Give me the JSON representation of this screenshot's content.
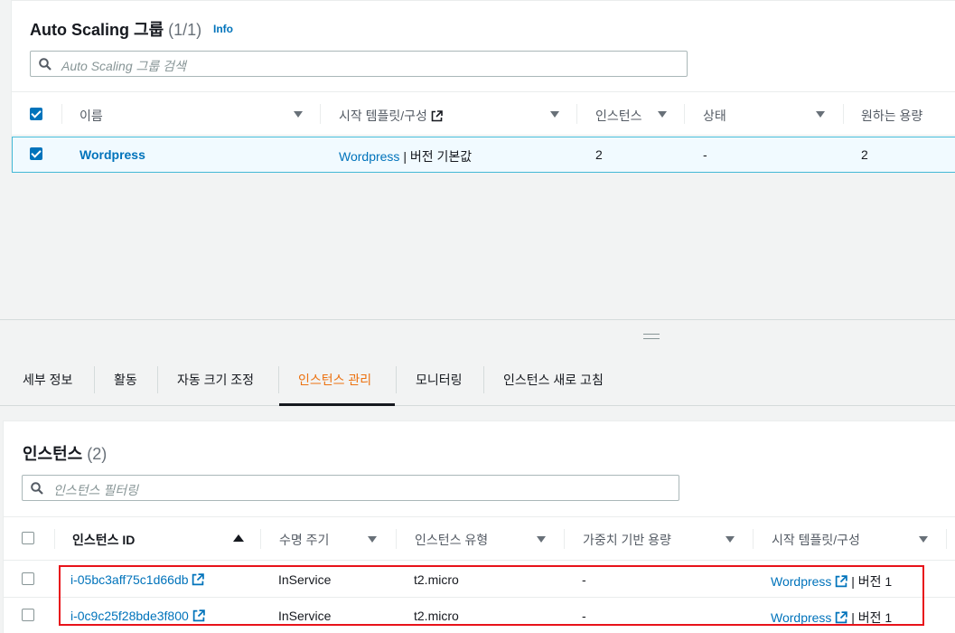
{
  "top": {
    "title": "Auto Scaling 그룹",
    "count": "(1/1)",
    "info": "Info",
    "search_placeholder": "Auto Scaling 그룹 검색",
    "columns": [
      "이름",
      "시작 템플릿/구성",
      "인스턴스",
      "상태",
      "원하는 용량"
    ],
    "row": {
      "name": "Wordpress",
      "template_link": "Wordpress",
      "template_suffix": " | 버전 기본값",
      "instances": "2",
      "status": "-",
      "desired": "2"
    }
  },
  "tabs": [
    "세부 정보",
    "활동",
    "자동 크기 조정",
    "인스턴스 관리",
    "모니터링",
    "인스턴스 새로 고침"
  ],
  "active_tab": "인스턴스 관리",
  "bottom": {
    "title": "인스턴스",
    "count": "(2)",
    "search_placeholder": "인스턴스 필터링",
    "columns": [
      "인스턴스 ID",
      "수명 주기",
      "인스턴스 유형",
      "가중치 기반 용량",
      "시작 템플릿/구성"
    ],
    "rows": [
      {
        "id": "i-05bc3aff75c1d66db",
        "lifecycle": "InService",
        "type": "t2.micro",
        "weight": "-",
        "template_link": "Wordpress",
        "template_suffix": " | 버전 1"
      },
      {
        "id": "i-0c9c25f28bde3f800",
        "lifecycle": "InService",
        "type": "t2.micro",
        "weight": "-",
        "template_link": "Wordpress",
        "template_suffix": " | 버전 1"
      }
    ]
  },
  "colors": {
    "link": "#0073bb",
    "active_tab": "#ec7211",
    "highlight": "#e8131a",
    "selected_row": "#f1faff"
  }
}
